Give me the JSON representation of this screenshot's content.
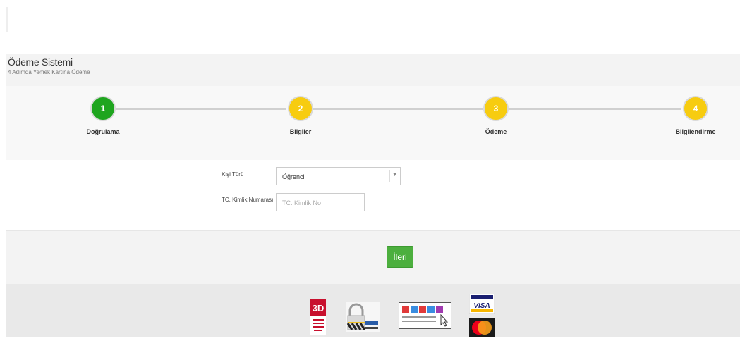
{
  "header": {
    "title": "Ödeme Sistemi",
    "subtitle": "4 Adımda Yemek Kartına Ödeme"
  },
  "wizard": {
    "steps": [
      {
        "number": "1",
        "label": "Doğrulama",
        "status": "complete",
        "color": "#1fa51f"
      },
      {
        "number": "2",
        "label": "Bilgiler",
        "status": "pending",
        "color": "#f7cc10"
      },
      {
        "number": "3",
        "label": "Ödeme",
        "status": "pending",
        "color": "#f7cc10"
      },
      {
        "number": "4",
        "label": "Bilgilendirme",
        "status": "pending",
        "color": "#f7cc10"
      }
    ]
  },
  "form": {
    "person_type_label": "Kişi Türü",
    "person_type_value": "Öğrenci",
    "tc_label": "TC. Kimlik Numarası",
    "tc_placeholder": "TC. Kimlik No",
    "tc_value": ""
  },
  "actions": {
    "next_label": "İleri"
  },
  "footer": {
    "secure_3d_logo": "3D",
    "lock_logo": "RapidSSL",
    "secure_shopping_logo": "İnternette Güvenli Alışveriş",
    "visa_logo": "VISA",
    "mastercard_logo": "MasterCard"
  }
}
